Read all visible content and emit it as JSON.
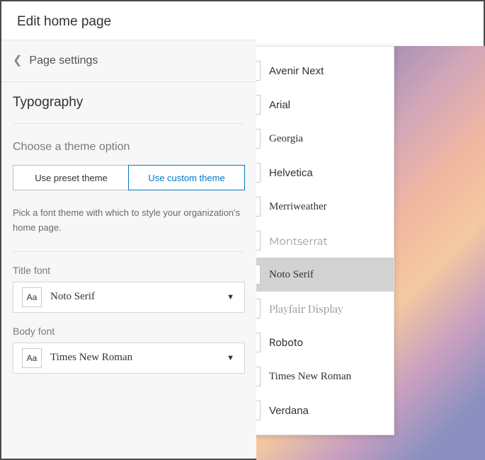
{
  "header": {
    "title": "Edit home page"
  },
  "breadcrumb": {
    "label": "Page settings"
  },
  "typography": {
    "title": "Typography",
    "choose_label": "Choose a theme option",
    "tab_preset": "Use preset theme",
    "tab_custom": "Use custom theme",
    "helper": "Pick a font theme with which to style your organization's home page.",
    "title_font_label": "Title font",
    "body_font_label": "Body font",
    "title_font_value": "Noto Serif",
    "body_font_value": "Times New Roman",
    "aa": "Aa"
  },
  "dropdown": {
    "items": [
      {
        "label": "Avenir Next",
        "font": "f-avenir"
      },
      {
        "label": "Arial",
        "font": "f-arial"
      },
      {
        "label": "Georgia",
        "font": "f-georgia"
      },
      {
        "label": "Helvetica",
        "font": "f-helvetica"
      },
      {
        "label": "Merriweather",
        "font": "f-merri"
      },
      {
        "label": "Montserrat",
        "font": "f-mont",
        "muted": true
      },
      {
        "label": "Noto Serif",
        "font": "f-noto",
        "selected": true
      },
      {
        "label": "Playfair Display",
        "font": "f-playfair",
        "muted": true
      },
      {
        "label": "Roboto",
        "font": "f-roboto"
      },
      {
        "label": "Times New Roman",
        "font": "f-times"
      },
      {
        "label": "Verdana",
        "font": "f-verdana"
      }
    ]
  }
}
